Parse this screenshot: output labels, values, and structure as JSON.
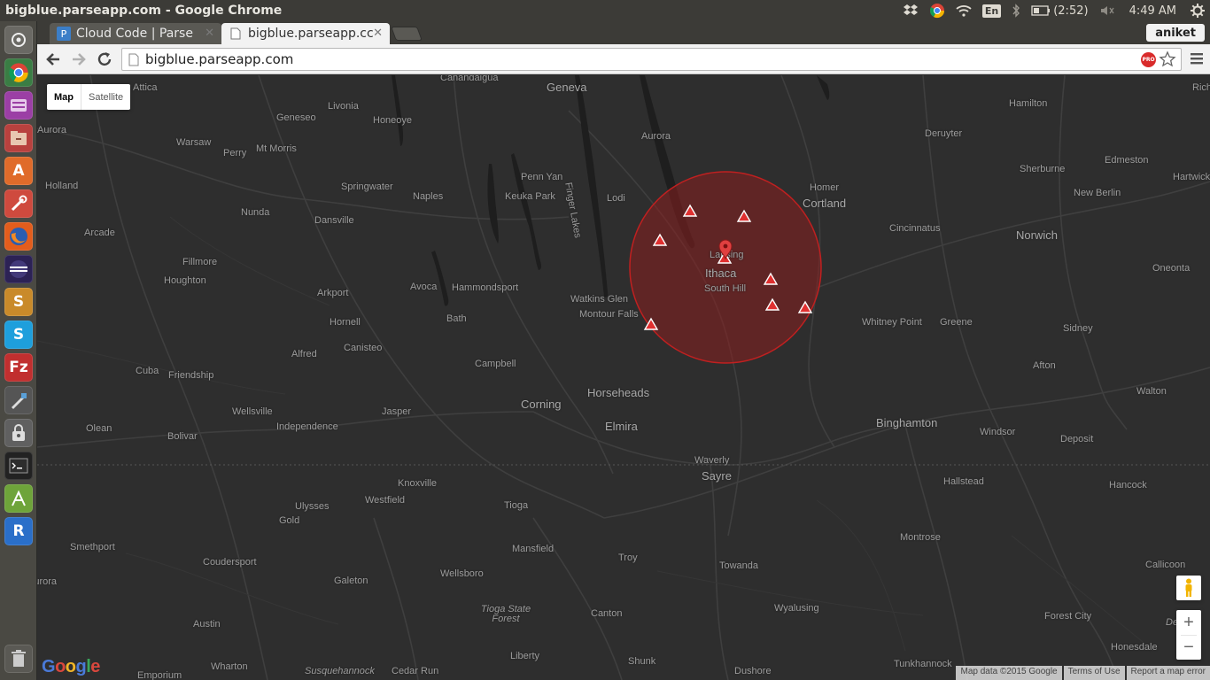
{
  "window": {
    "title": "bigblue.parseapp.com - Google Chrome"
  },
  "tray": {
    "input_lang": "En",
    "battery": "(2:52)",
    "clock": "4:49 AM"
  },
  "tabs": [
    {
      "label": "Cloud Code | Parse",
      "favicon": "P"
    },
    {
      "label": "bigblue.parseapp.cc"
    }
  ],
  "user": "aniket",
  "address_bar": {
    "url": "bigblue.parseapp.com",
    "pro_badge": "PRO"
  },
  "map": {
    "type_control": {
      "map": "Map",
      "satellite": "Satellite"
    },
    "places": [
      {
        "name": "Canandaigua"
      },
      {
        "name": "Geneva"
      },
      {
        "name": "Attica"
      },
      {
        "name": "Livonia"
      },
      {
        "name": "Geneseo"
      },
      {
        "name": "Honeoye"
      },
      {
        "name": "Aurora"
      },
      {
        "name": "Warsaw"
      },
      {
        "name": "Mt Morris"
      },
      {
        "name": "Perry"
      },
      {
        "name": "Holland"
      },
      {
        "name": "Springwater"
      },
      {
        "name": "Naples"
      },
      {
        "name": "Penn Yan"
      },
      {
        "name": "Keuka Park"
      },
      {
        "name": "Finger Lakes"
      },
      {
        "name": "Lodi"
      },
      {
        "name": "Aurora"
      },
      {
        "name": "Homer"
      },
      {
        "name": "Cortland"
      },
      {
        "name": "Nunda"
      },
      {
        "name": "Dansville"
      },
      {
        "name": "Arcade"
      },
      {
        "name": "Fillmore"
      },
      {
        "name": "Houghton"
      },
      {
        "name": "Arkport"
      },
      {
        "name": "Avoca"
      },
      {
        "name": "Hammondsport"
      },
      {
        "name": "Watkins Glen"
      },
      {
        "name": "Montour Falls"
      },
      {
        "name": "Bath"
      },
      {
        "name": "Hornell"
      },
      {
        "name": "Canisteo"
      },
      {
        "name": "Alfred"
      },
      {
        "name": "Campbell"
      },
      {
        "name": "Cuba"
      },
      {
        "name": "Friendship"
      },
      {
        "name": "Horseheads"
      },
      {
        "name": "Corning"
      },
      {
        "name": "Wellsville"
      },
      {
        "name": "Jasper"
      },
      {
        "name": "Elmira"
      },
      {
        "name": "Independence"
      },
      {
        "name": "Olean"
      },
      {
        "name": "Bolivar"
      },
      {
        "name": "Waverly"
      },
      {
        "name": "Sayre"
      },
      {
        "name": "Knoxville"
      },
      {
        "name": "Ulysses"
      },
      {
        "name": "Westfield"
      },
      {
        "name": "Tioga"
      },
      {
        "name": "Gold"
      },
      {
        "name": "Smethport"
      },
      {
        "name": "Mansfield"
      },
      {
        "name": "Coudersport"
      },
      {
        "name": "Troy"
      },
      {
        "name": "Towanda"
      },
      {
        "name": "Wellsboro"
      },
      {
        "name": "Galeton"
      },
      {
        "name": "Tioga State Forest"
      },
      {
        "name": "Canton"
      },
      {
        "name": "Wyalusing"
      },
      {
        "name": "Austin"
      },
      {
        "name": "Liberty"
      },
      {
        "name": "Wharton"
      },
      {
        "name": "Susquehannock"
      },
      {
        "name": "Cedar Run"
      },
      {
        "name": "Shunk"
      },
      {
        "name": "Dushore"
      },
      {
        "name": "Emporium"
      },
      {
        "name": "Lansing"
      },
      {
        "name": "Ithaca"
      },
      {
        "name": "South Hill"
      },
      {
        "name": "Deruyter"
      },
      {
        "name": "Hamilton"
      },
      {
        "name": "Sherburne"
      },
      {
        "name": "Edmeston"
      },
      {
        "name": "Hartwick"
      },
      {
        "name": "New Berlin"
      },
      {
        "name": "Cincinnatus"
      },
      {
        "name": "Norwich"
      },
      {
        "name": "Oneonta"
      },
      {
        "name": "Whitney Point"
      },
      {
        "name": "Greene"
      },
      {
        "name": "Sidney"
      },
      {
        "name": "Afton"
      },
      {
        "name": "Walton"
      },
      {
        "name": "Binghamton"
      },
      {
        "name": "Windsor"
      },
      {
        "name": "Deposit"
      },
      {
        "name": "Hallstead"
      },
      {
        "name": "Hancock"
      },
      {
        "name": "Montrose"
      },
      {
        "name": "Callicoon"
      },
      {
        "name": "Forest City"
      },
      {
        "name": "Honesdale"
      },
      {
        "name": "Tunkhannock"
      },
      {
        "name": "Aurora"
      },
      {
        "name": "Rich"
      },
      {
        "name": "Dele"
      }
    ],
    "attribution": {
      "data": "Map data ©2015 Google",
      "terms": "Terms of Use",
      "report": "Report a map error"
    },
    "logo": "Google",
    "zoom": {
      "in": "+",
      "out": "−"
    },
    "colors": {
      "circle_fill": "#8b1f1f",
      "circle_stroke": "#c02020",
      "marker": "#e03030"
    }
  }
}
